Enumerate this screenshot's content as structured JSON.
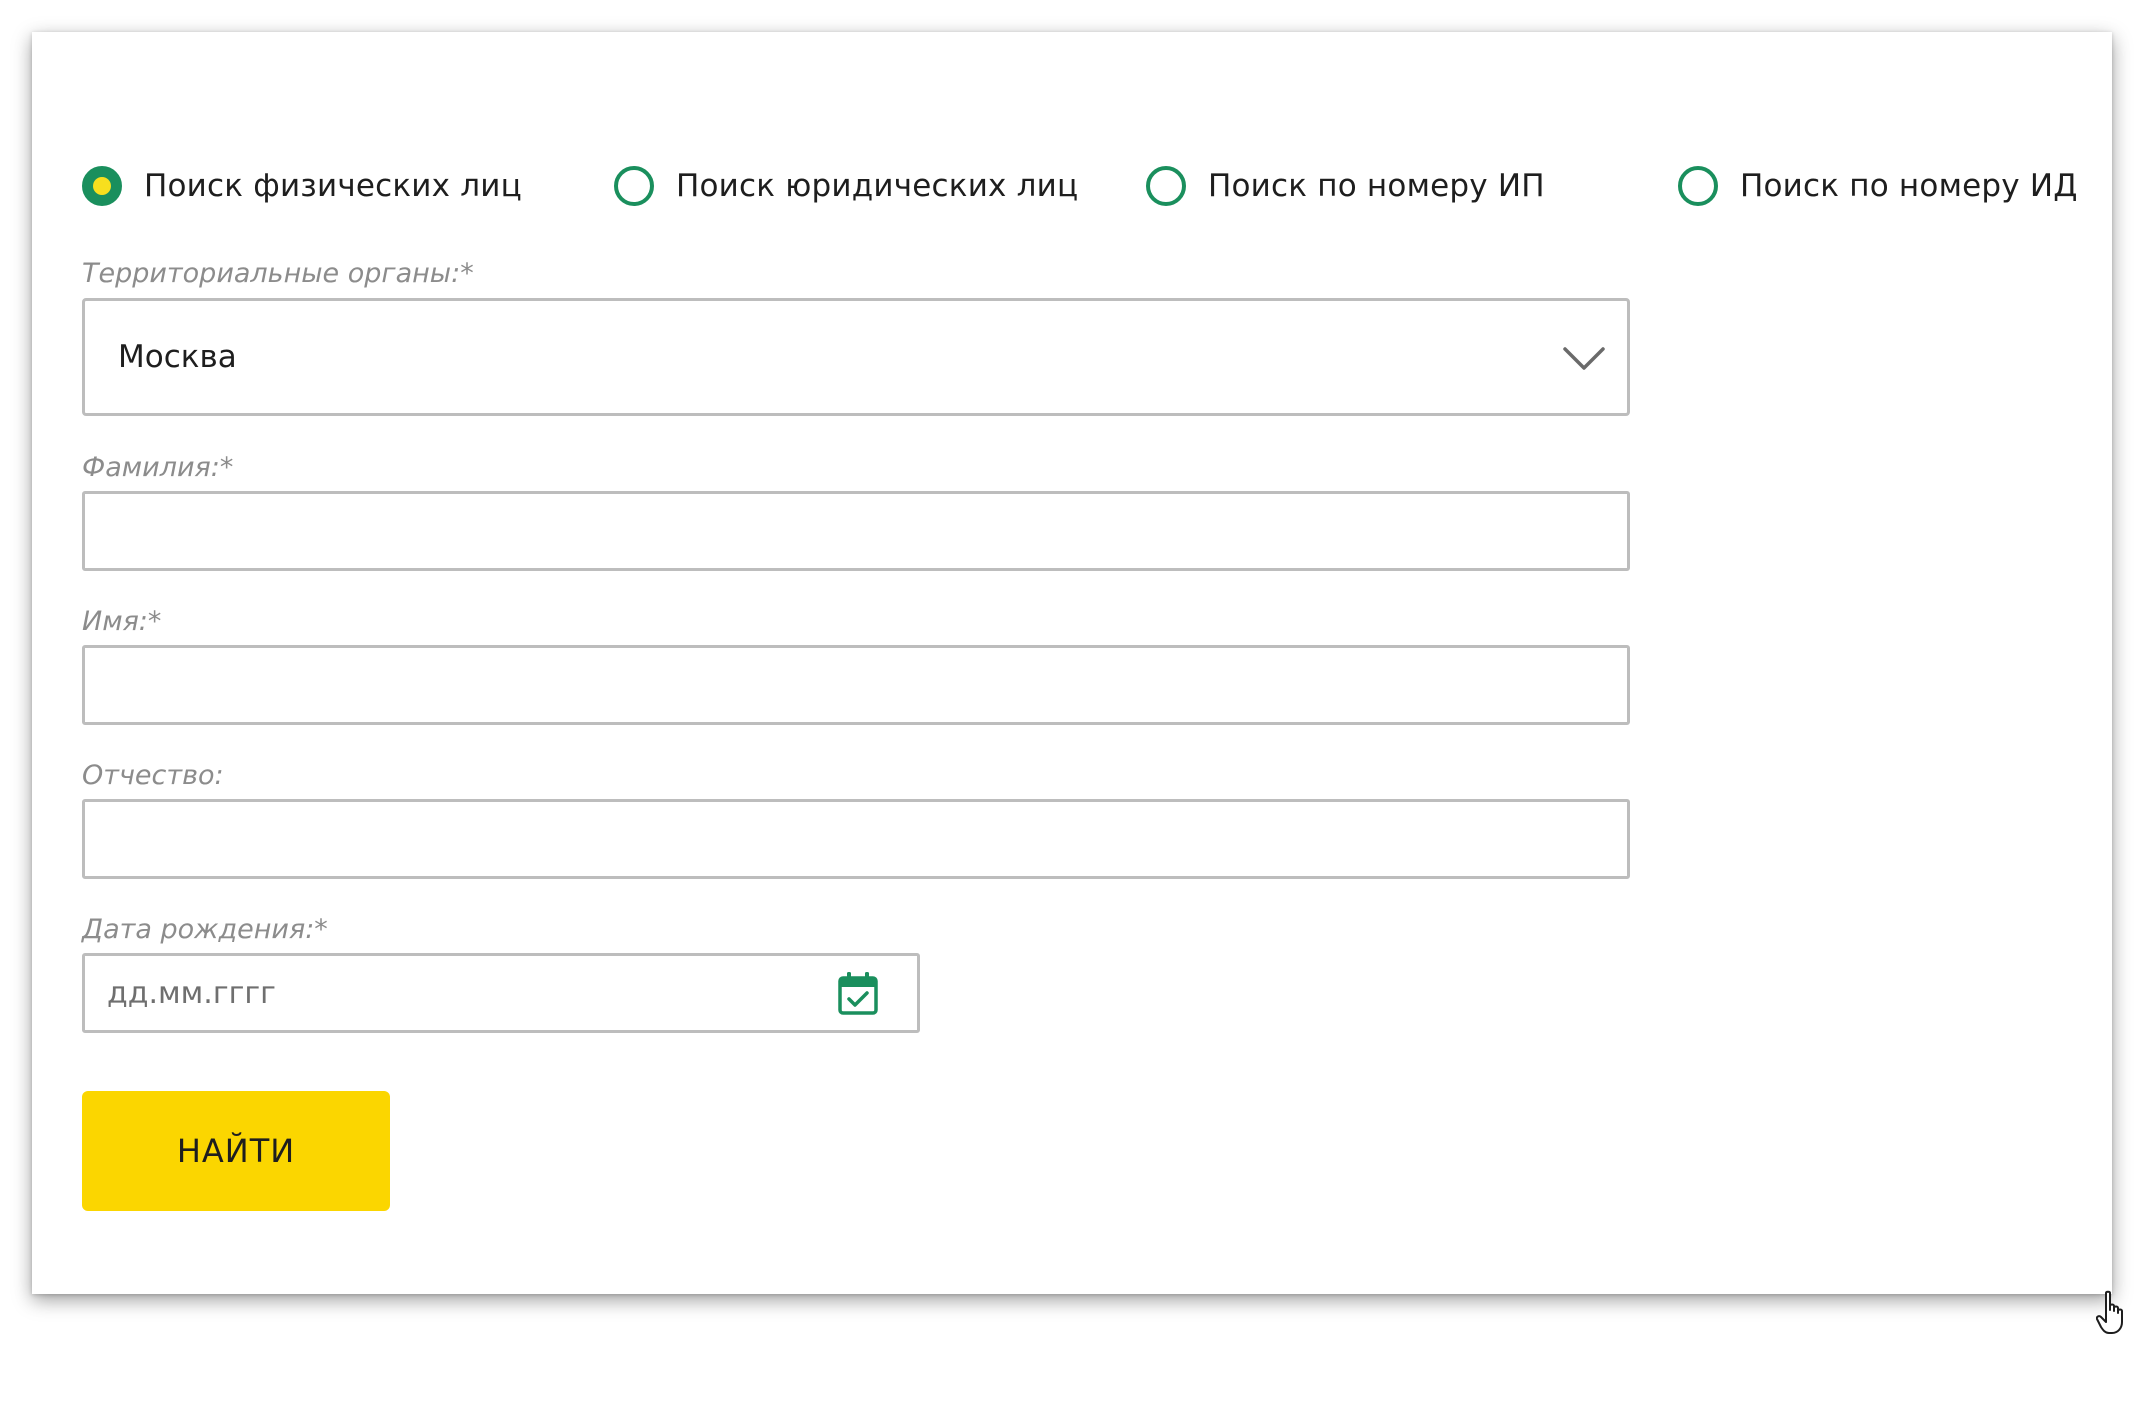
{
  "search_modes": [
    {
      "label": "Поиск физических лиц",
      "checked": true
    },
    {
      "label": "Поиск юридических лиц",
      "checked": false
    },
    {
      "label": "Поиск по номеру ИП",
      "checked": false
    },
    {
      "label": "Поиск по номеру ИД",
      "checked": false
    }
  ],
  "form": {
    "region": {
      "label": "Территориальные органы:*",
      "value": "Москва"
    },
    "last_name": {
      "label": "Фамилия:*",
      "value": ""
    },
    "first_name": {
      "label": "Имя:*",
      "value": ""
    },
    "patronymic": {
      "label": "Отчество:",
      "value": ""
    },
    "birth_date": {
      "label": "Дата рождения:*",
      "placeholder": "дд.мм.гггг",
      "value": ""
    },
    "submit_label": "НАЙТИ"
  },
  "colors": {
    "accent_green": "#1a8f5d",
    "radio_dot_yellow": "#f7df1e",
    "button_yellow": "#fbd600",
    "border_gray": "#bdbdbd",
    "label_gray": "#8c8c8c"
  },
  "icons": {
    "select_arrow": "chevron-down-icon",
    "date_picker": "calendar-check-icon",
    "pointer": "hand-cursor-icon"
  }
}
